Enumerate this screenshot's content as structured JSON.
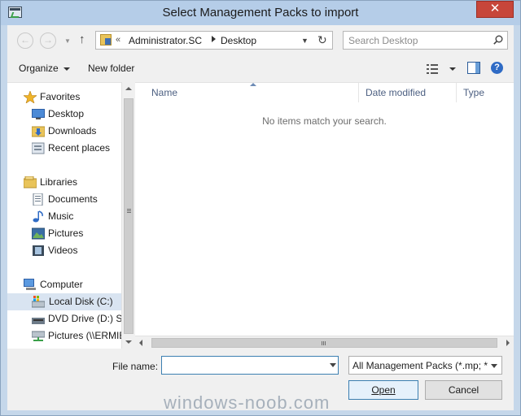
{
  "window": {
    "title": "Select Management Packs to import",
    "close_label": "✕"
  },
  "navigation": {
    "back_icon": "back-arrow-icon",
    "forward_icon": "forward-arrow-icon",
    "up_icon": "up-arrow-icon",
    "address": {
      "overflow": "«",
      "crumbs": [
        "Administrator.SC",
        "Desktop"
      ]
    },
    "search_placeholder": "Search Desktop"
  },
  "toolbar": {
    "organize_label": "Organize",
    "new_folder_label": "New folder"
  },
  "tree": {
    "favorites": {
      "label": "Favorites",
      "items": [
        "Desktop",
        "Downloads",
        "Recent places"
      ]
    },
    "libraries": {
      "label": "Libraries",
      "items": [
        "Documents",
        "Music",
        "Pictures",
        "Videos"
      ]
    },
    "computer": {
      "label": "Computer",
      "items": [
        "Local Disk (C:)",
        "DVD Drive (D:) SC",
        "Pictures (\\\\ERMIE"
      ]
    },
    "selected": "Local Disk (C:)"
  },
  "list": {
    "columns": [
      "Name",
      "Date modified",
      "Type"
    ],
    "empty_message": "No items match your search."
  },
  "footer": {
    "file_name_label": "File name:",
    "file_name_value": "",
    "filter_value": "All Management Packs (*.mp; *",
    "open_label": "Open",
    "cancel_label": "Cancel"
  },
  "watermark": "windows-noob.com",
  "colors": {
    "accent": "#3c7fb1",
    "selection": "#d9e4f1",
    "close": "#c7463a"
  }
}
